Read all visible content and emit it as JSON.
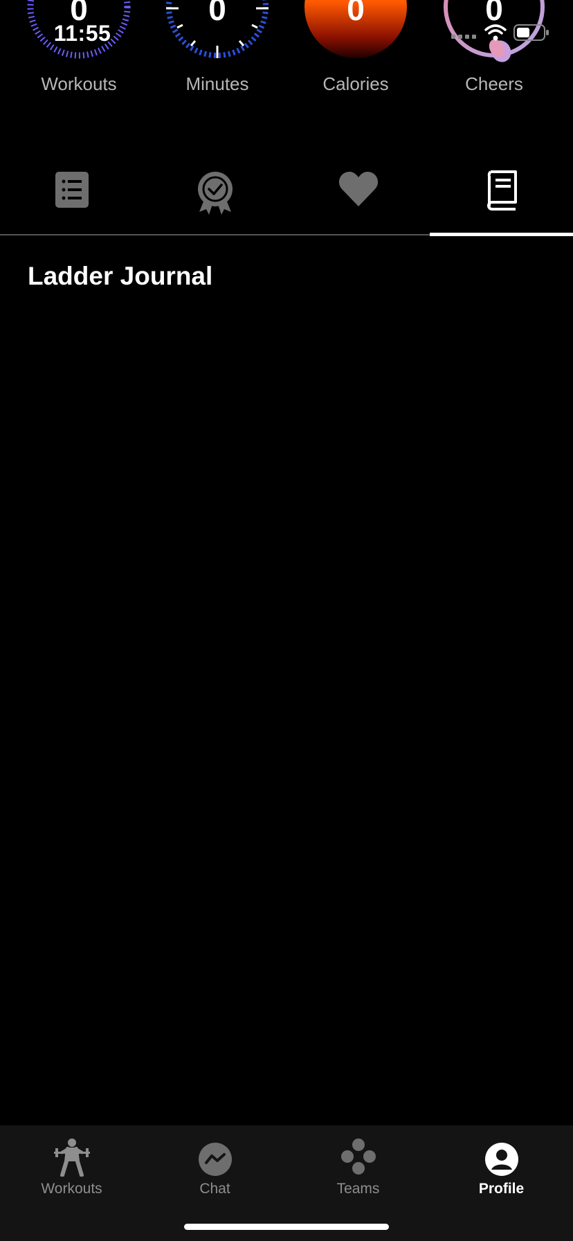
{
  "status_bar": {
    "time": "11:55"
  },
  "stats": [
    {
      "value": "0",
      "label": "Workouts"
    },
    {
      "value": "0",
      "label": "Minutes"
    },
    {
      "value": "0",
      "label": "Calories"
    },
    {
      "value": "0",
      "label": "Cheers"
    }
  ],
  "tabs": [
    {
      "icon": "list-icon",
      "active": false
    },
    {
      "icon": "award-badge-icon",
      "active": false
    },
    {
      "icon": "heart-icon",
      "active": false
    },
    {
      "icon": "journal-book-icon",
      "active": true
    }
  ],
  "section": {
    "title": "Ladder Journal"
  },
  "bottom_nav": [
    {
      "label": "Workouts",
      "icon": "weightlifter-icon",
      "active": false
    },
    {
      "label": "Chat",
      "icon": "chat-bubble-icon",
      "active": false
    },
    {
      "label": "Teams",
      "icon": "teams-dots-icon",
      "active": false
    },
    {
      "label": "Profile",
      "icon": "person-icon",
      "active": true
    }
  ],
  "colors": {
    "background": "#000000",
    "nav_background": "#141414",
    "inactive": "#8e8e8e",
    "workouts_ring": "#6a5cff",
    "minutes_ring": "#2b4fd8",
    "calories_top": "#ff7a00",
    "cheers_ring": "#d8a0c8"
  }
}
